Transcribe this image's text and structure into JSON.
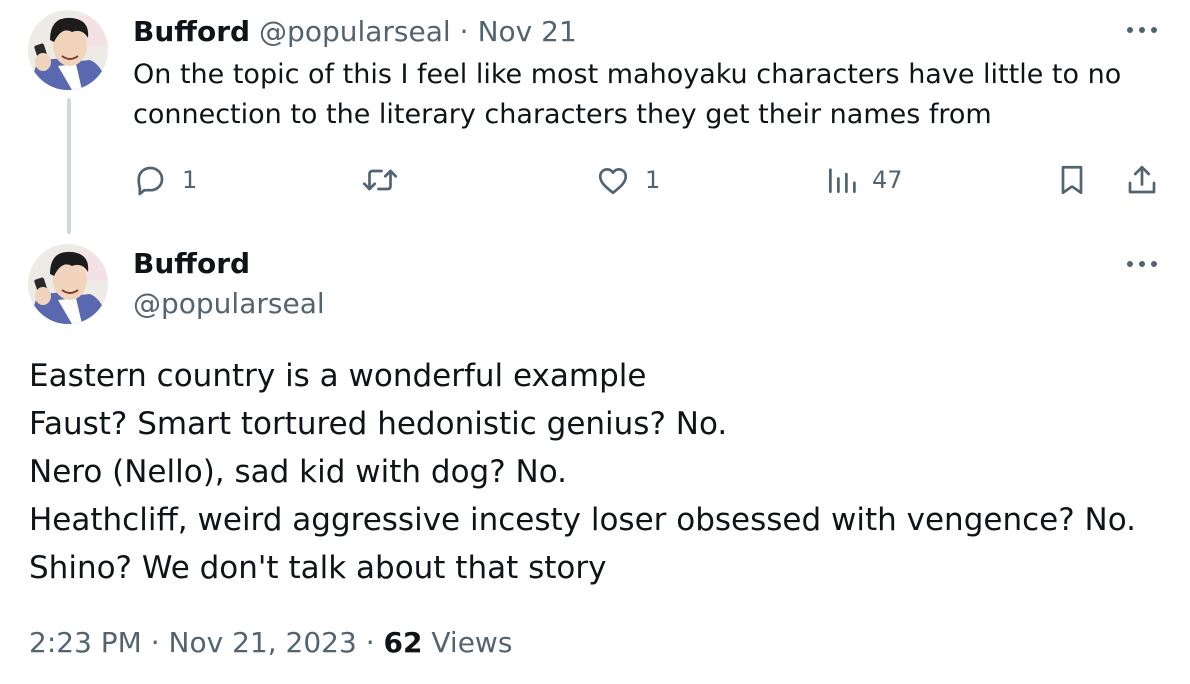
{
  "colors": {
    "text_primary": "#0f1419",
    "text_secondary": "#536471",
    "thread_line": "#cfd9de",
    "background": "#ffffff"
  },
  "reply_tweet": {
    "display_name": "Bufford",
    "handle": "@popularseal",
    "separator": "·",
    "date": "Nov 21",
    "text": "On the topic of this I feel like most mahoyaku characters have little to no connection to the literary characters they get their names from",
    "actions": {
      "reply_icon": "reply-icon",
      "reply_count": "1",
      "retweet_icon": "retweet-icon",
      "like_icon": "heart-icon",
      "like_count": "1",
      "views_icon": "bar-chart-icon",
      "views_count": "47",
      "bookmark_icon": "bookmark-icon",
      "share_icon": "share-icon"
    }
  },
  "main_tweet": {
    "display_name": "Bufford",
    "handle": "@popularseal",
    "lines": [
      "Eastern country is a wonderful example",
      "Faust? Smart tortured hedonistic genius? No.",
      "Nero (Nello), sad kid with dog? No.",
      "Heathcliff, weird aggressive incesty loser obsessed with vengence? No.",
      "Shino? We don't talk about that story"
    ],
    "time": "2:23 PM",
    "separator": "·",
    "date": "Nov 21, 2023",
    "views_count": "62",
    "views_label": "Views"
  }
}
